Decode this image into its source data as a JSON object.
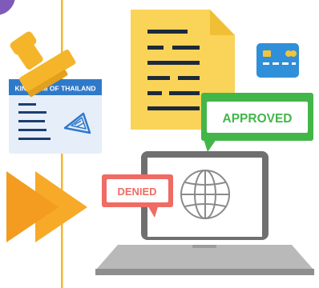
{
  "visa_card": {
    "header_text": "KINGDOM OF THAILAND"
  },
  "badges": {
    "approved": {
      "label": "APPROVED",
      "color": "#43b649"
    },
    "denied": {
      "label": "DENIED",
      "color": "#ef6b63"
    }
  },
  "colors": {
    "accent_purple": "#7e5bb8",
    "timeline_yellow": "#f5b72d",
    "stamp_yellow": "#f5b52a",
    "document_yellow": "#f9d458",
    "card_blue": "#2f8fd8",
    "laptop_gray": "#6f6f6f",
    "arrows_orange": "#f39c1f"
  },
  "icons": [
    "rubber-stamp-icon",
    "visa-card-icon",
    "document-icon",
    "credit-card-icon",
    "laptop-icon",
    "globe-icon",
    "fast-forward-arrows-icon"
  ]
}
